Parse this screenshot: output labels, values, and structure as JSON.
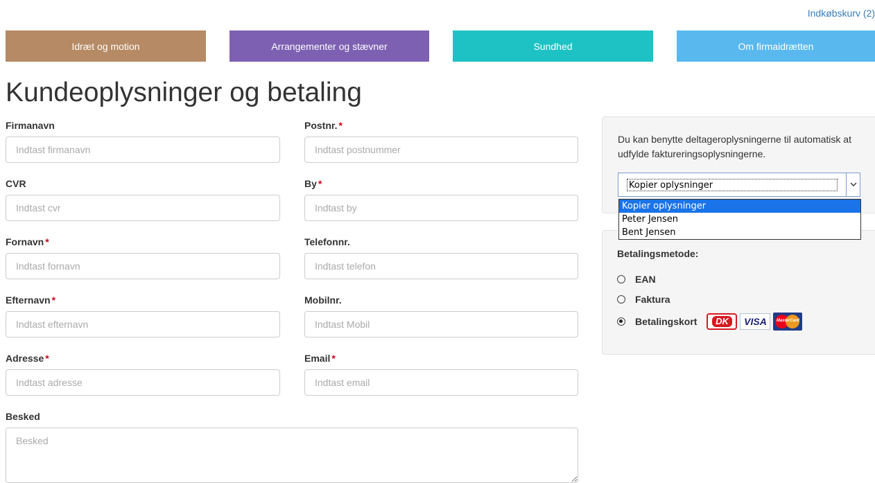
{
  "header": {
    "cart_label": "Indkøbskurv (2)"
  },
  "nav": [
    {
      "label": "Idræt og motion",
      "color": "#b58a64"
    },
    {
      "label": "Arrangementer og stævner",
      "color": "#7d60b2"
    },
    {
      "label": "Sundhed",
      "color": "#1fc2c4"
    },
    {
      "label": "Om firmaidrætten",
      "color": "#59b9ef"
    }
  ],
  "page": {
    "title": "Kundeoplysninger og betaling"
  },
  "form": {
    "company": {
      "label": "Firmanavn",
      "placeholder": "Indtast firmanavn"
    },
    "cvr": {
      "label": "CVR",
      "placeholder": "Indtast cvr"
    },
    "firstname": {
      "label": "Fornavn",
      "placeholder": "Indtast fornavn",
      "required_mark": "*"
    },
    "lastname": {
      "label": "Efternavn",
      "placeholder": "Indtast efternavn",
      "required_mark": "*"
    },
    "address": {
      "label": "Adresse",
      "placeholder": "Indtast adresse",
      "required_mark": "*"
    },
    "postcode": {
      "label": "Postnr.",
      "placeholder": "Indtast postnummer",
      "required_mark": "*"
    },
    "city": {
      "label": "By",
      "placeholder": "Indtast by",
      "required_mark": "*"
    },
    "phone": {
      "label": "Telefonnr.",
      "placeholder": "Indtast telefon"
    },
    "mobile": {
      "label": "Mobilnr.",
      "placeholder": "Indtast Mobil"
    },
    "email": {
      "label": "Email",
      "placeholder": "Indtast email",
      "required_mark": "*"
    },
    "message": {
      "label": "Besked",
      "placeholder": "Besked"
    }
  },
  "copy_panel": {
    "text": "Du kan benytte deltageroplysningerne til automatisk at udfylde faktureringsoplysningerne.",
    "selected": "Kopier oplysninger",
    "options": [
      "Kopier oplysninger",
      "Peter Jensen",
      "Bent Jensen"
    ]
  },
  "payment": {
    "title": "Betalingsmetode:",
    "options": [
      {
        "label": "EAN",
        "checked": false
      },
      {
        "label": "Faktura",
        "checked": false
      },
      {
        "label": "Betalingskort",
        "checked": true
      }
    ],
    "card_logos": [
      "Dankort",
      "VISA",
      "MasterCard"
    ]
  }
}
